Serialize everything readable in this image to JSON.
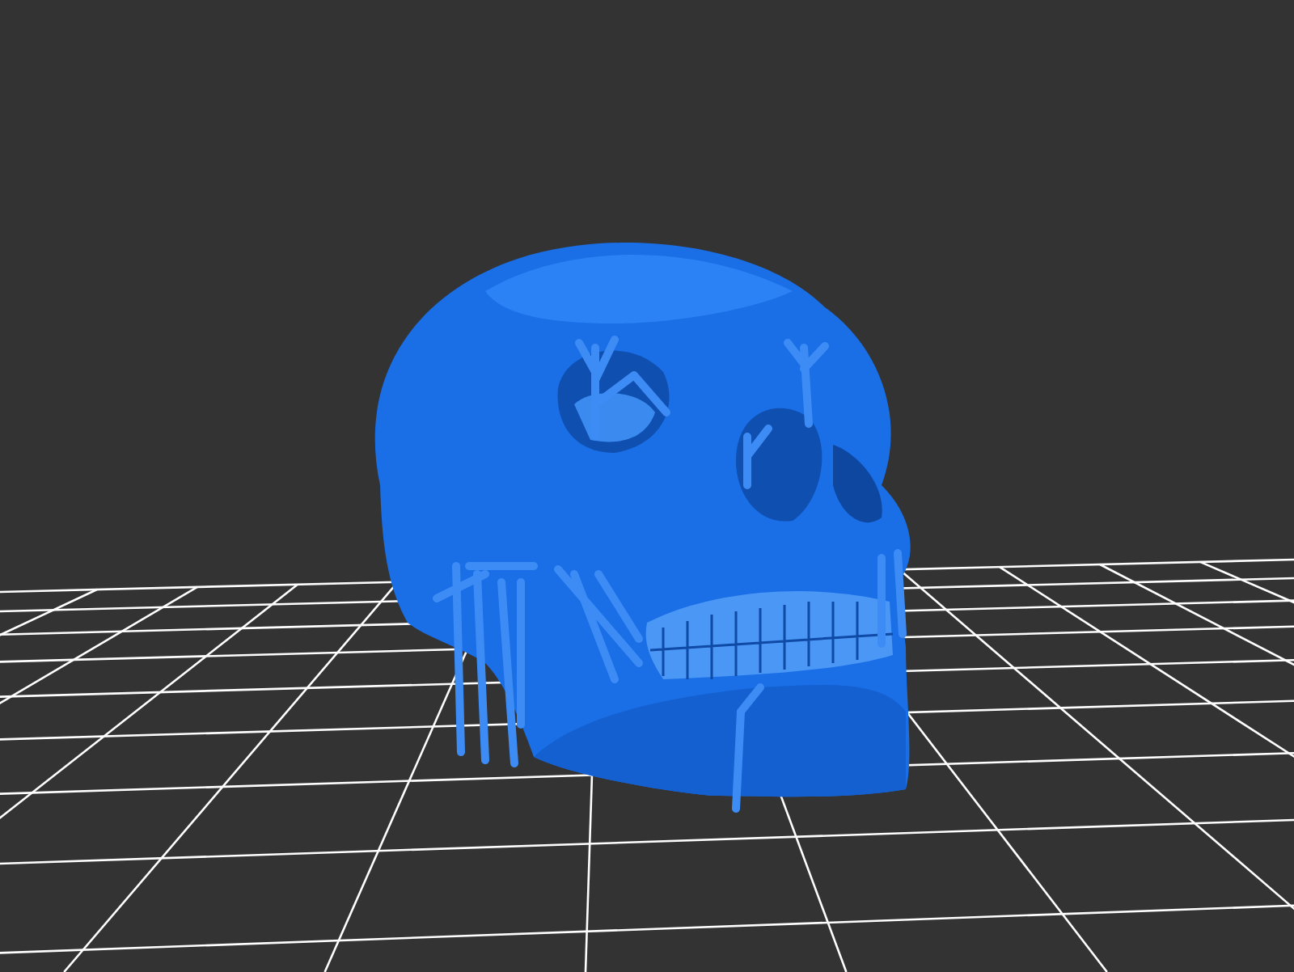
{
  "viewport": {
    "grid_visible": true,
    "supports_visible": true
  }
}
